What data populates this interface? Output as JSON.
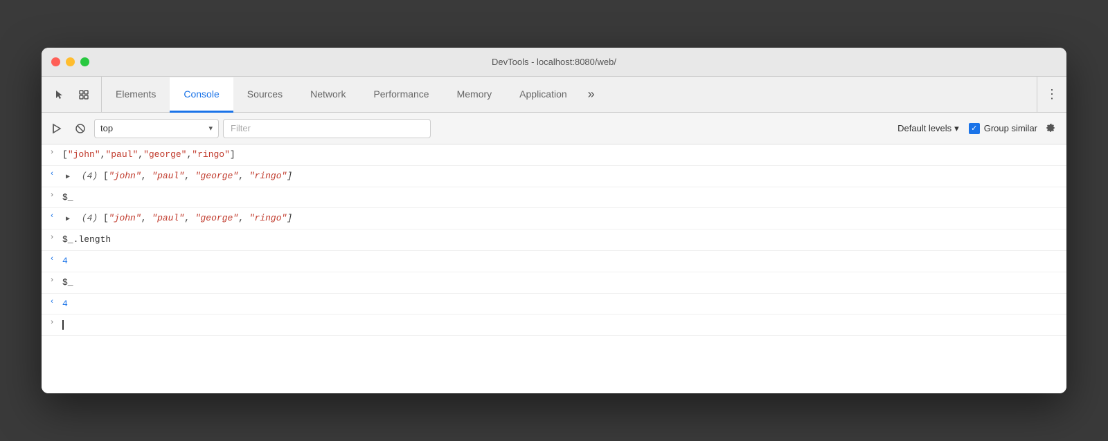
{
  "window": {
    "title": "DevTools - localhost:8080/web/"
  },
  "tabs": {
    "icon1": "⬜",
    "icon2": "⧉",
    "items": [
      {
        "id": "elements",
        "label": "Elements",
        "active": false
      },
      {
        "id": "console",
        "label": "Console",
        "active": true
      },
      {
        "id": "sources",
        "label": "Sources",
        "active": false
      },
      {
        "id": "network",
        "label": "Network",
        "active": false
      },
      {
        "id": "performance",
        "label": "Performance",
        "active": false
      },
      {
        "id": "memory",
        "label": "Memory",
        "active": false
      },
      {
        "id": "application",
        "label": "Application",
        "active": false
      }
    ],
    "more_label": "»",
    "menu_icon": "⋮"
  },
  "toolbar": {
    "preserve_icon": "▷",
    "clear_icon": "🚫",
    "context_label": "top",
    "context_arrow": "▾",
    "filter_placeholder": "Filter",
    "default_levels_label": "Default levels",
    "default_levels_arrow": "▾",
    "group_similar_label": "Group similar",
    "gear_icon": "⚙"
  },
  "console_rows": [
    {
      "id": "row1",
      "direction": ">",
      "direction_class": "arrow-gray",
      "content_type": "plain",
      "text": "[\"john\",\"paul\",\"george\",\"ringo\"]"
    },
    {
      "id": "row2",
      "direction": "<",
      "direction_class": "arrow-blue",
      "content_type": "array",
      "count": "(4)",
      "items": [
        "\"john\"",
        "\"paul\"",
        "\"george\"",
        "\"ringo\""
      ]
    },
    {
      "id": "row3",
      "direction": ">",
      "direction_class": "arrow-gray",
      "content_type": "plain",
      "text": "$_"
    },
    {
      "id": "row4",
      "direction": "<",
      "direction_class": "arrow-blue",
      "content_type": "array",
      "count": "(4)",
      "items": [
        "\"john\"",
        "\"paul\"",
        "\"george\"",
        "\"ringo\""
      ]
    },
    {
      "id": "row5",
      "direction": ">",
      "direction_class": "arrow-gray",
      "content_type": "plain",
      "text": "$_.length"
    },
    {
      "id": "row6",
      "direction": "<",
      "direction_class": "arrow-blue",
      "content_type": "number",
      "value": "4"
    },
    {
      "id": "row7",
      "direction": ">",
      "direction_class": "arrow-gray",
      "content_type": "plain",
      "text": "$_"
    },
    {
      "id": "row8",
      "direction": "<",
      "direction_class": "arrow-blue",
      "content_type": "number",
      "value": "4"
    },
    {
      "id": "row9",
      "direction": ">",
      "direction_class": "arrow-gray",
      "content_type": "input",
      "text": ""
    }
  ]
}
